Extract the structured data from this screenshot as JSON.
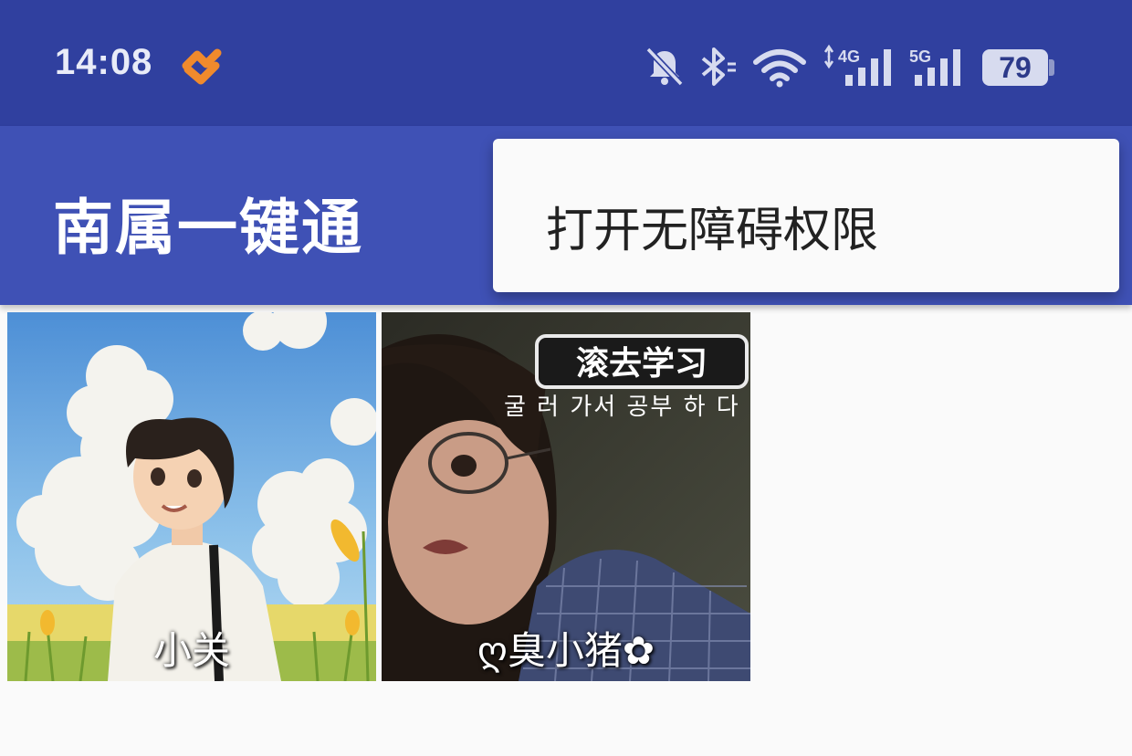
{
  "status_bar": {
    "time": "14:08",
    "battery": "79",
    "net1_label": "4G",
    "net2_label": "5G",
    "icons": [
      "app-notification-icon",
      "bell-muted-icon",
      "bluetooth-icon",
      "wifi-icon",
      "signal-4g-icon",
      "signal-5g-icon",
      "battery-icon"
    ]
  },
  "app_bar": {
    "title": "南属一键通"
  },
  "menu": {
    "items": [
      {
        "label": "打开无障碍权限"
      }
    ]
  },
  "grid": [
    {
      "name": "小关",
      "image": "anime-boy-in-field"
    },
    {
      "name": "ღ臭小猪✿",
      "image": "girl-meme-photo",
      "overlay_title": "滚去学习",
      "overlay_subtitle": "굴 러 가서 공부 하 다"
    }
  ],
  "colors": {
    "status_bar": "#30409f",
    "app_bar": "#3f51b5",
    "menu_bg": "#fafafa",
    "background": "#fafafa"
  }
}
